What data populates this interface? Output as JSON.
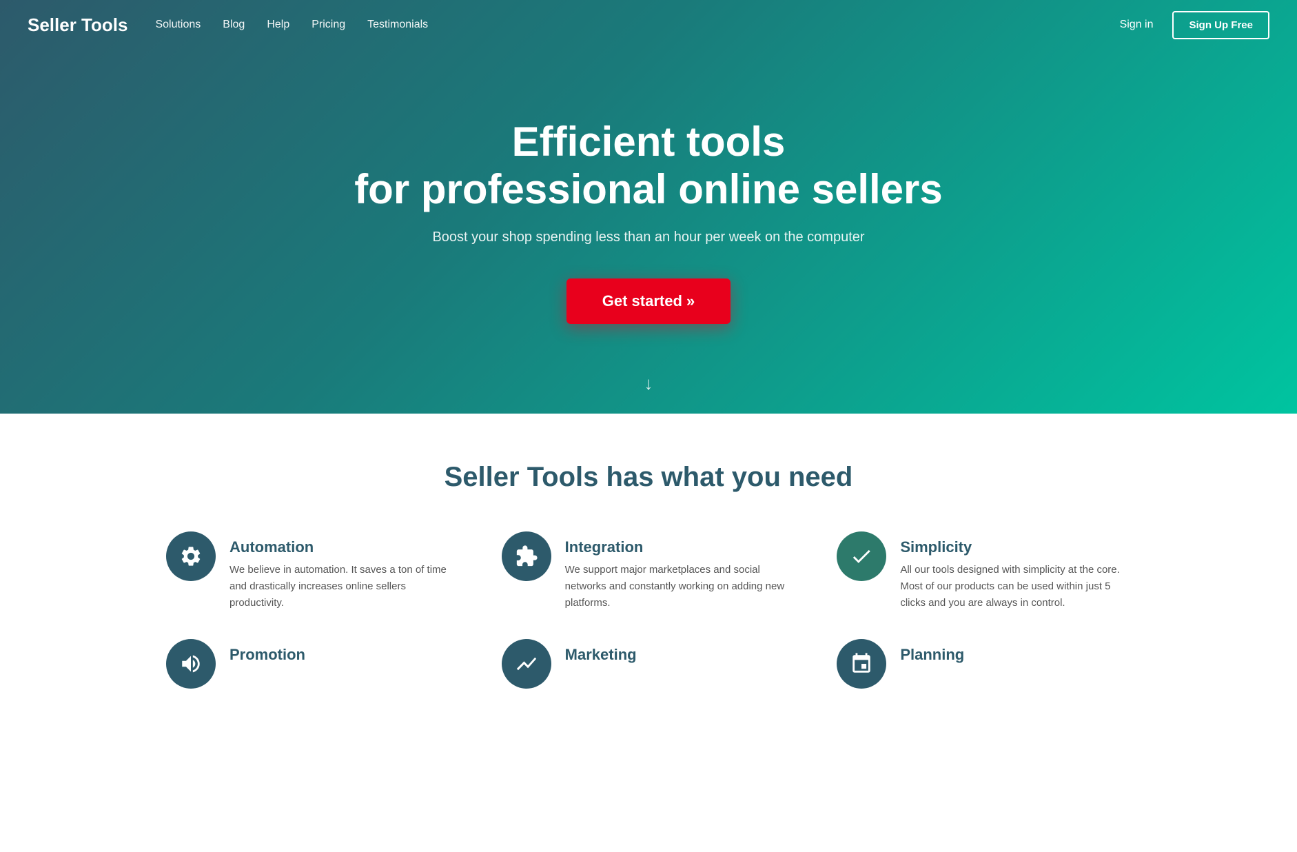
{
  "nav": {
    "logo": "Seller Tools",
    "links": [
      {
        "label": "Solutions",
        "href": "#"
      },
      {
        "label": "Blog",
        "href": "#"
      },
      {
        "label": "Help",
        "href": "#"
      },
      {
        "label": "Pricing",
        "href": "#"
      },
      {
        "label": "Testimonials",
        "href": "#"
      }
    ],
    "signin_label": "Sign in",
    "signup_label": "Sign Up Free"
  },
  "hero": {
    "title_line1": "Efficient tools",
    "title_line2": "for professional online sellers",
    "subtitle": "Boost your shop spending less than an hour per week on the computer",
    "cta_label": "Get started »",
    "arrow": "↓"
  },
  "features_section": {
    "title": "Seller Tools has what you need",
    "items": [
      {
        "id": "automation",
        "icon": "gear",
        "heading": "Automation",
        "description": "We believe in automation. It saves a ton of time and drastically increases online sellers productivity."
      },
      {
        "id": "integration",
        "icon": "puzzle",
        "heading": "Integration",
        "description": "We support major marketplaces and social networks and constantly working on adding new platforms."
      },
      {
        "id": "simplicity",
        "icon": "check",
        "heading": "Simplicity",
        "description": "All our tools designed with simplicity at the core. Most of our products can be used within just 5 clicks and you are always in control."
      },
      {
        "id": "promotion",
        "icon": "megaphone",
        "heading": "Promotion",
        "description": ""
      },
      {
        "id": "marketing",
        "icon": "chart",
        "heading": "Marketing",
        "description": ""
      },
      {
        "id": "planning",
        "icon": "calendar",
        "heading": "Planning",
        "description": ""
      }
    ]
  }
}
